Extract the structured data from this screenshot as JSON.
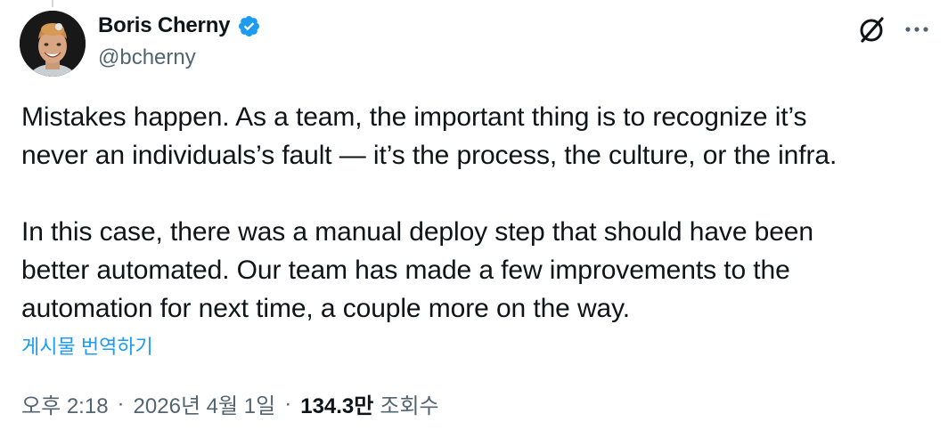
{
  "author": {
    "display_name": "Boris Cherny",
    "handle": "@bcherny",
    "verified": true,
    "verified_color": "#1d9bf0"
  },
  "header_actions": {
    "grok_icon": "grok-icon",
    "more_icon": "more-horizontal-icon"
  },
  "tweet": {
    "paragraph1_lines": [
      "Mistakes happen. As a team, the important thing is to recognize it’s",
      "never an individuals’s fault — it’s the process, the culture, or the infra."
    ],
    "paragraph2_lines": [
      "In this case, there was a manual deploy step that should have been",
      "better automated. Our team has made a few improvements to the",
      "automation for next time, a couple more on the way."
    ],
    "translate_label": "게시물 번역하기"
  },
  "meta": {
    "time": "오후 2:18",
    "date": "2026년 4월 1일",
    "views_count": "134.3만",
    "views_label": "조회수",
    "separator": "·"
  },
  "colors": {
    "text_primary": "#0f1419",
    "text_secondary": "#536471",
    "link": "#1d9bf0"
  }
}
